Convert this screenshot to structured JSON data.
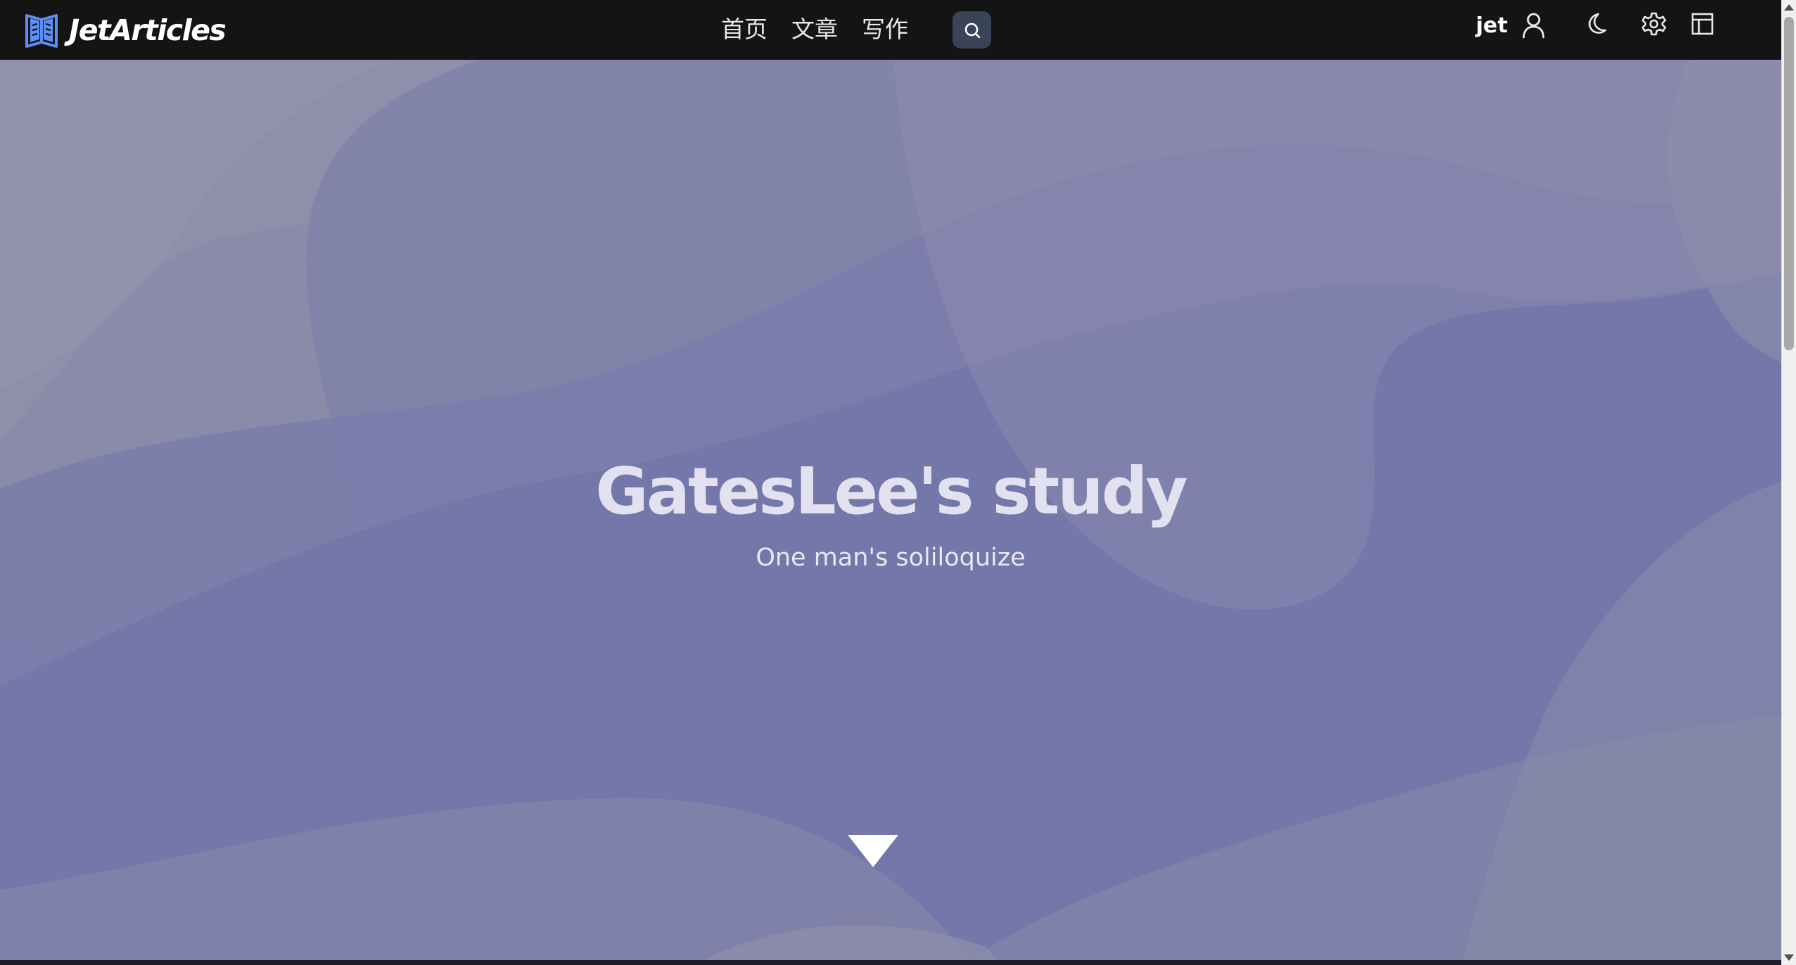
{
  "header": {
    "brand": "JetArticles",
    "nav": [
      {
        "label": "首页"
      },
      {
        "label": "文章"
      },
      {
        "label": "写作"
      }
    ],
    "user": "jet"
  },
  "icons": {
    "logo": "book-icon",
    "search": "search-icon",
    "user": "user-icon",
    "theme": "moon-icon",
    "settings": "gear-icon",
    "layout": "layout-icon",
    "scroll": "triangle-down-icon"
  },
  "hero": {
    "title": "GatesLee's study",
    "subtitle": "One man's soliloquize"
  },
  "colors": {
    "header_bg": "#141414",
    "hero_base": "#8e8fab",
    "hero_accent": "#7275a9",
    "logo_blue": "#5b8ff5",
    "search_bg": "#3a4457"
  }
}
